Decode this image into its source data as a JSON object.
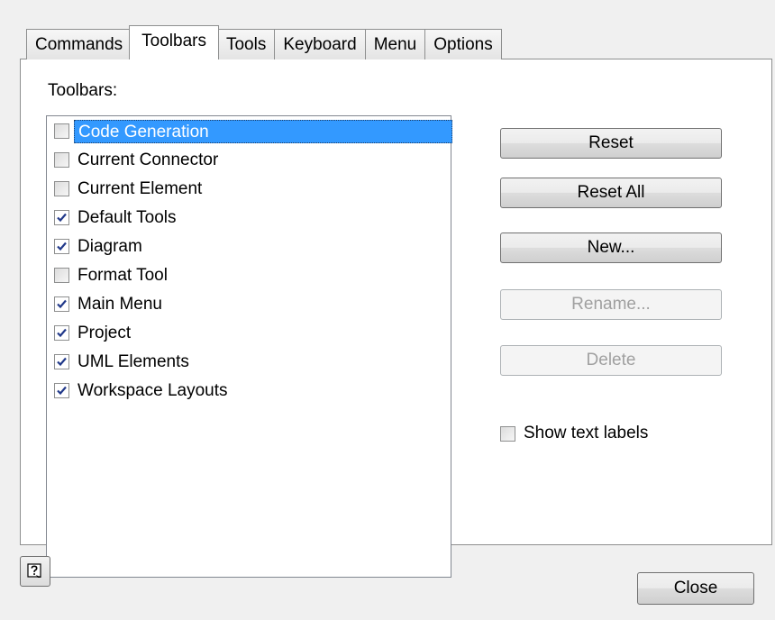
{
  "tabs": [
    {
      "label": "Commands",
      "active": false
    },
    {
      "label": "Toolbars",
      "active": true
    },
    {
      "label": "Tools",
      "active": false
    },
    {
      "label": "Keyboard",
      "active": false
    },
    {
      "label": "Menu",
      "active": false
    },
    {
      "label": "Options",
      "active": false
    }
  ],
  "toolbars_label": "Toolbars:",
  "toolbars": [
    {
      "label": "Code Generation",
      "checked": false,
      "selected": true
    },
    {
      "label": "Current Connector",
      "checked": false,
      "selected": false
    },
    {
      "label": "Current Element",
      "checked": false,
      "selected": false
    },
    {
      "label": "Default Tools",
      "checked": true,
      "selected": false
    },
    {
      "label": "Diagram",
      "checked": true,
      "selected": false
    },
    {
      "label": "Format Tool",
      "checked": false,
      "selected": false
    },
    {
      "label": "Main Menu",
      "checked": true,
      "selected": false
    },
    {
      "label": "Project",
      "checked": true,
      "selected": false
    },
    {
      "label": "UML Elements",
      "checked": true,
      "selected": false
    },
    {
      "label": "Workspace Layouts",
      "checked": true,
      "selected": false
    }
  ],
  "buttons": {
    "reset": "Reset",
    "reset_all": "Reset All",
    "new": "New...",
    "rename": "Rename...",
    "delete": "Delete"
  },
  "show_text_labels": {
    "label": "Show text labels",
    "checked": false
  },
  "footer": {
    "help_icon": "help-icon",
    "close": "Close"
  },
  "colors": {
    "selection": "#3399ff",
    "check": "#21398a"
  }
}
